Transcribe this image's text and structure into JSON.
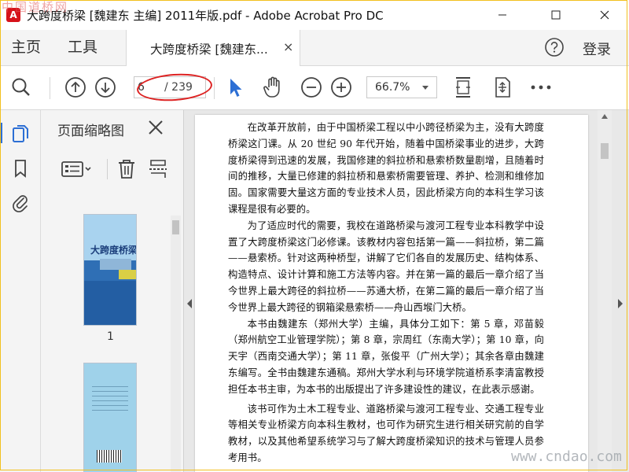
{
  "window": {
    "title": "大跨度桥梁 [魏建东 主编] 2011年版.pdf - Adobe Acrobat Pro DC",
    "app_icon_glyph": "A",
    "watermark_top": "中国道桥网",
    "watermark_bottom": "www.cndao.com"
  },
  "tabs": {
    "home": "主页",
    "tools": "工具",
    "document": "大跨度桥梁 [魏建东...",
    "close_glyph": "×",
    "login": "登录"
  },
  "toolbar": {
    "page_current": "6",
    "page_total": "/ 239",
    "zoom": "66.7%",
    "icons": [
      "search-icon",
      "page-up-icon",
      "page-down-icon",
      "select-arrow-icon",
      "hand-icon",
      "zoom-out-icon",
      "zoom-in-icon",
      "fit-width-icon",
      "fit-page-icon",
      "more-icon"
    ]
  },
  "sidebar": {
    "pane_title": "页面缩略图",
    "thumbnails": [
      {
        "label": "1",
        "cover_title": "大跨度桥梁"
      }
    ]
  },
  "document": {
    "paragraphs": [
      "在改革开放前，由于中国桥梁工程以中小跨径桥梁为主，没有大跨度桥梁这门课。从 20 世纪 90 年代开始，随着中国桥梁事业的进步，大跨度桥梁得到迅速的发展，我国修建的斜拉桥和悬索桥数量剧增，且随着时间的推移，大量已修建的斜拉桥和悬索桥需要管理、养护、检测和维修加固。国家需要大量这方面的专业技术人员，因此桥梁方向的本科生学习该课程是很有必要的。",
      "为了适应时代的需要，我校在道路桥梁与渡河工程专业本科教学中设置了大跨度桥梁这门必修课。该教材内容包括第一篇——斜拉桥，第二篇——悬索桥。针对这两种桥型，讲解了它们各自的发展历史、结构体系、构造特点、设计计算和施工方法等内容。并在第一篇的最后一章介绍了当今世界上最大跨径的斜拉桥——苏通大桥，在第二篇的最后一章介绍了当今世界上最大跨径的钢箱梁悬索桥——舟山西堠门大桥。",
      "本书由魏建东（郑州大学）主编，具体分工如下：第 5 章，邓苗毅（郑州航空工业管理学院）；第 8 章，宗周红（东南大学）；第 10 章，向天宇（西南交通大学）；第 11 章，张俊平（广州大学）；其余各章由魏建东编写。全书由魏建东通稿。郑州大学水利与环境学院道桥系李清富教授担任本书主审，为本书的出版提出了许多建设性的建议，在此表示感谢。",
      "该书可作为土木工程专业、道路桥梁与渡河工程专业、交通工程专业等相关专业桥梁方向本科生教材，也可作为研究生进行相关研究前的自学教材，以及其他希望系统学习与了解大跨度桥梁知识的技术与管理人员参考用书。"
    ]
  },
  "colors": {
    "accent": "#2d6fd4",
    "annotation_ring": "#dd2222",
    "acrobat_red": "#d6121a"
  }
}
